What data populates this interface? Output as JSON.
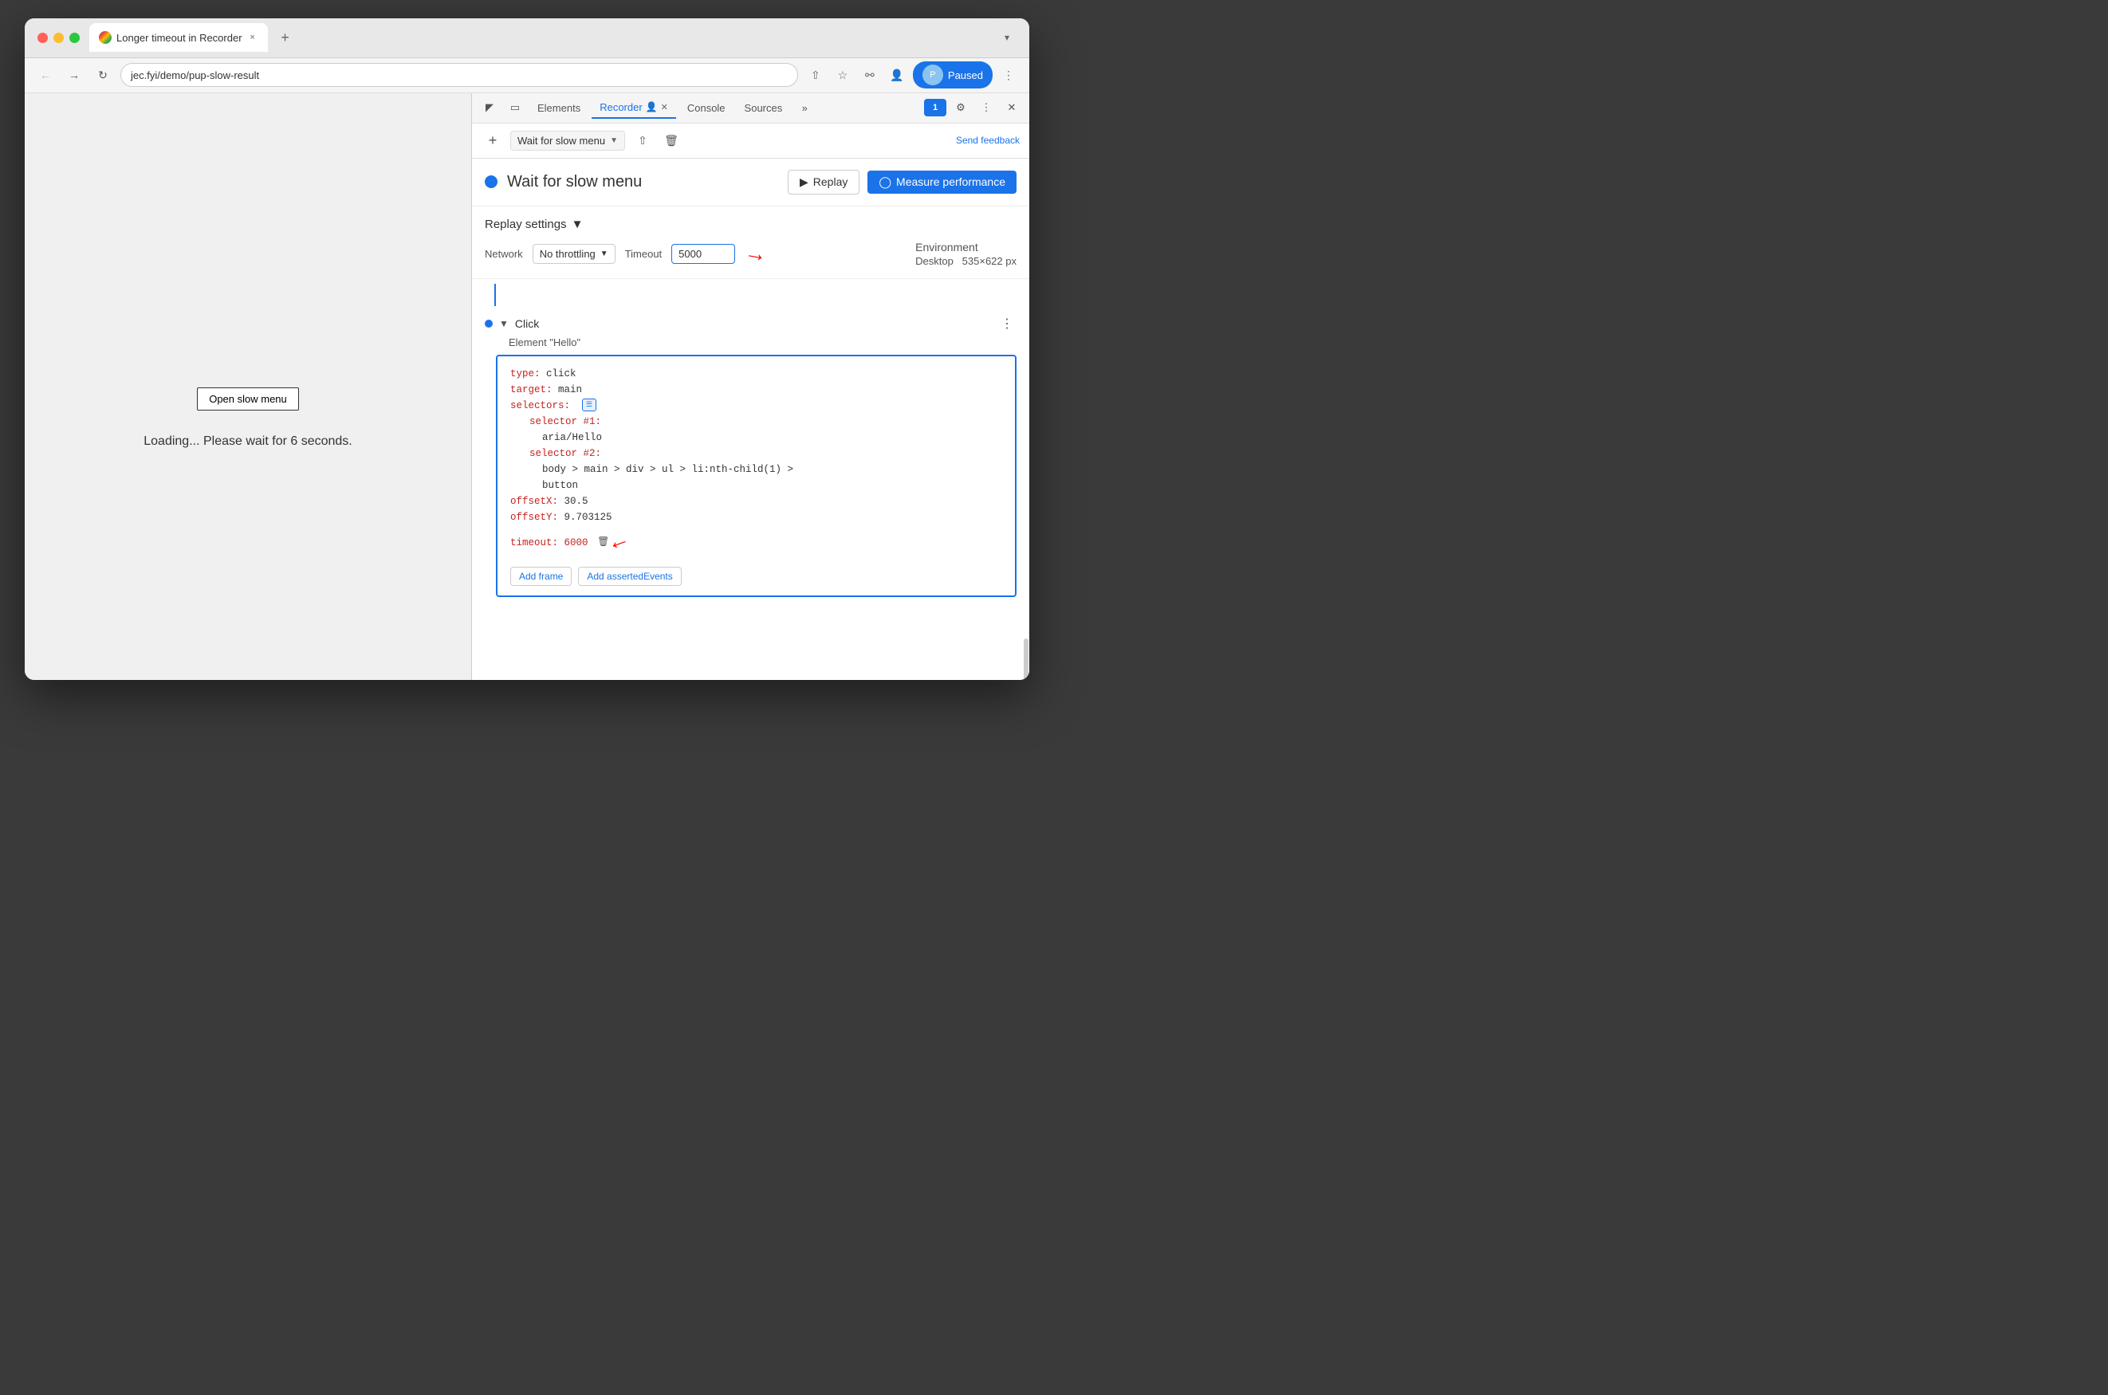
{
  "browser": {
    "tab_title": "Longer timeout in Recorder",
    "tab_close": "×",
    "tab_new": "+",
    "url": "jec.fyi/demo/pup-slow-result",
    "paused_label": "Paused",
    "chevron_down": "▾"
  },
  "devtools": {
    "tabs": [
      {
        "label": "Elements",
        "active": false
      },
      {
        "label": "Recorder",
        "active": true
      },
      {
        "label": "Console",
        "active": false
      },
      {
        "label": "Sources",
        "active": false
      }
    ],
    "feedback_count": "1",
    "send_feedback": "Send feedback"
  },
  "recorder": {
    "recording_name": "Wait for slow menu",
    "replay_label": "Replay",
    "measure_label": "Measure performance",
    "dot_color": "#1a73e8"
  },
  "replay_settings": {
    "header": "Replay settings",
    "network_label": "Network",
    "network_value": "No throttling",
    "timeout_label": "Timeout",
    "timeout_value": "5000",
    "env_label": "Environment",
    "env_value": "Desktop",
    "env_size": "535×622 px"
  },
  "step": {
    "name": "Click",
    "subtitle": "Element \"Hello\"",
    "code": {
      "type_key": "type:",
      "type_val": " click",
      "target_key": "target:",
      "target_val": " main",
      "selectors_key": "selectors:",
      "selector1_key": "selector #1:",
      "selector1_val": "aria/Hello",
      "selector2_key": "selector #2:",
      "selector2_val": "body > main > div > ul > li:nth-child(1) >",
      "selector2_val2": "button",
      "offsetx_key": "offsetX:",
      "offsetx_val": " 30.5",
      "offsety_key": "offsetY:",
      "offsety_val": " 9.703125",
      "timeout_key": "timeout:",
      "timeout_val": "6000",
      "add_frame_label": "Add frame",
      "add_asserted_label": "Add assertedEvents"
    }
  },
  "webpage": {
    "open_menu_btn": "Open slow menu",
    "loading_text": "Loading... Please wait for 6 seconds."
  }
}
